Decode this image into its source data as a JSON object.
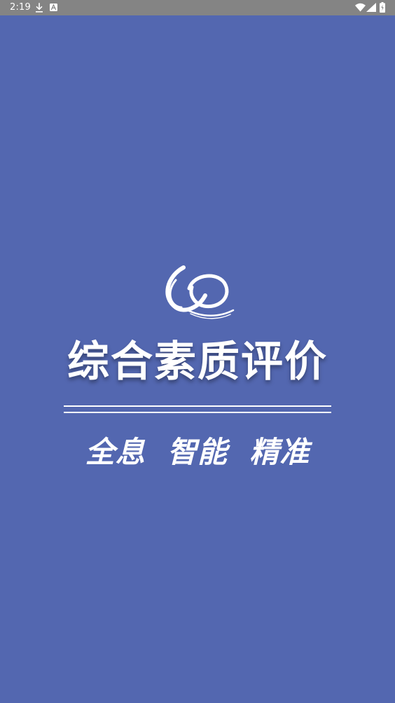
{
  "colors": {
    "status_bar": "#848484",
    "background": "#5367b0",
    "text": "#ffffff",
    "divider": "#ffffff"
  },
  "status_bar": {
    "time": "2:19",
    "left_icons": [
      "download-icon",
      "a-icon"
    ],
    "right_icons": [
      "wifi-icon",
      "signal-icon",
      "battery-icon"
    ]
  },
  "splash": {
    "logo_icon": "logo-icon",
    "title": "综合素质评价",
    "slogan": "全息  智能  精准"
  }
}
